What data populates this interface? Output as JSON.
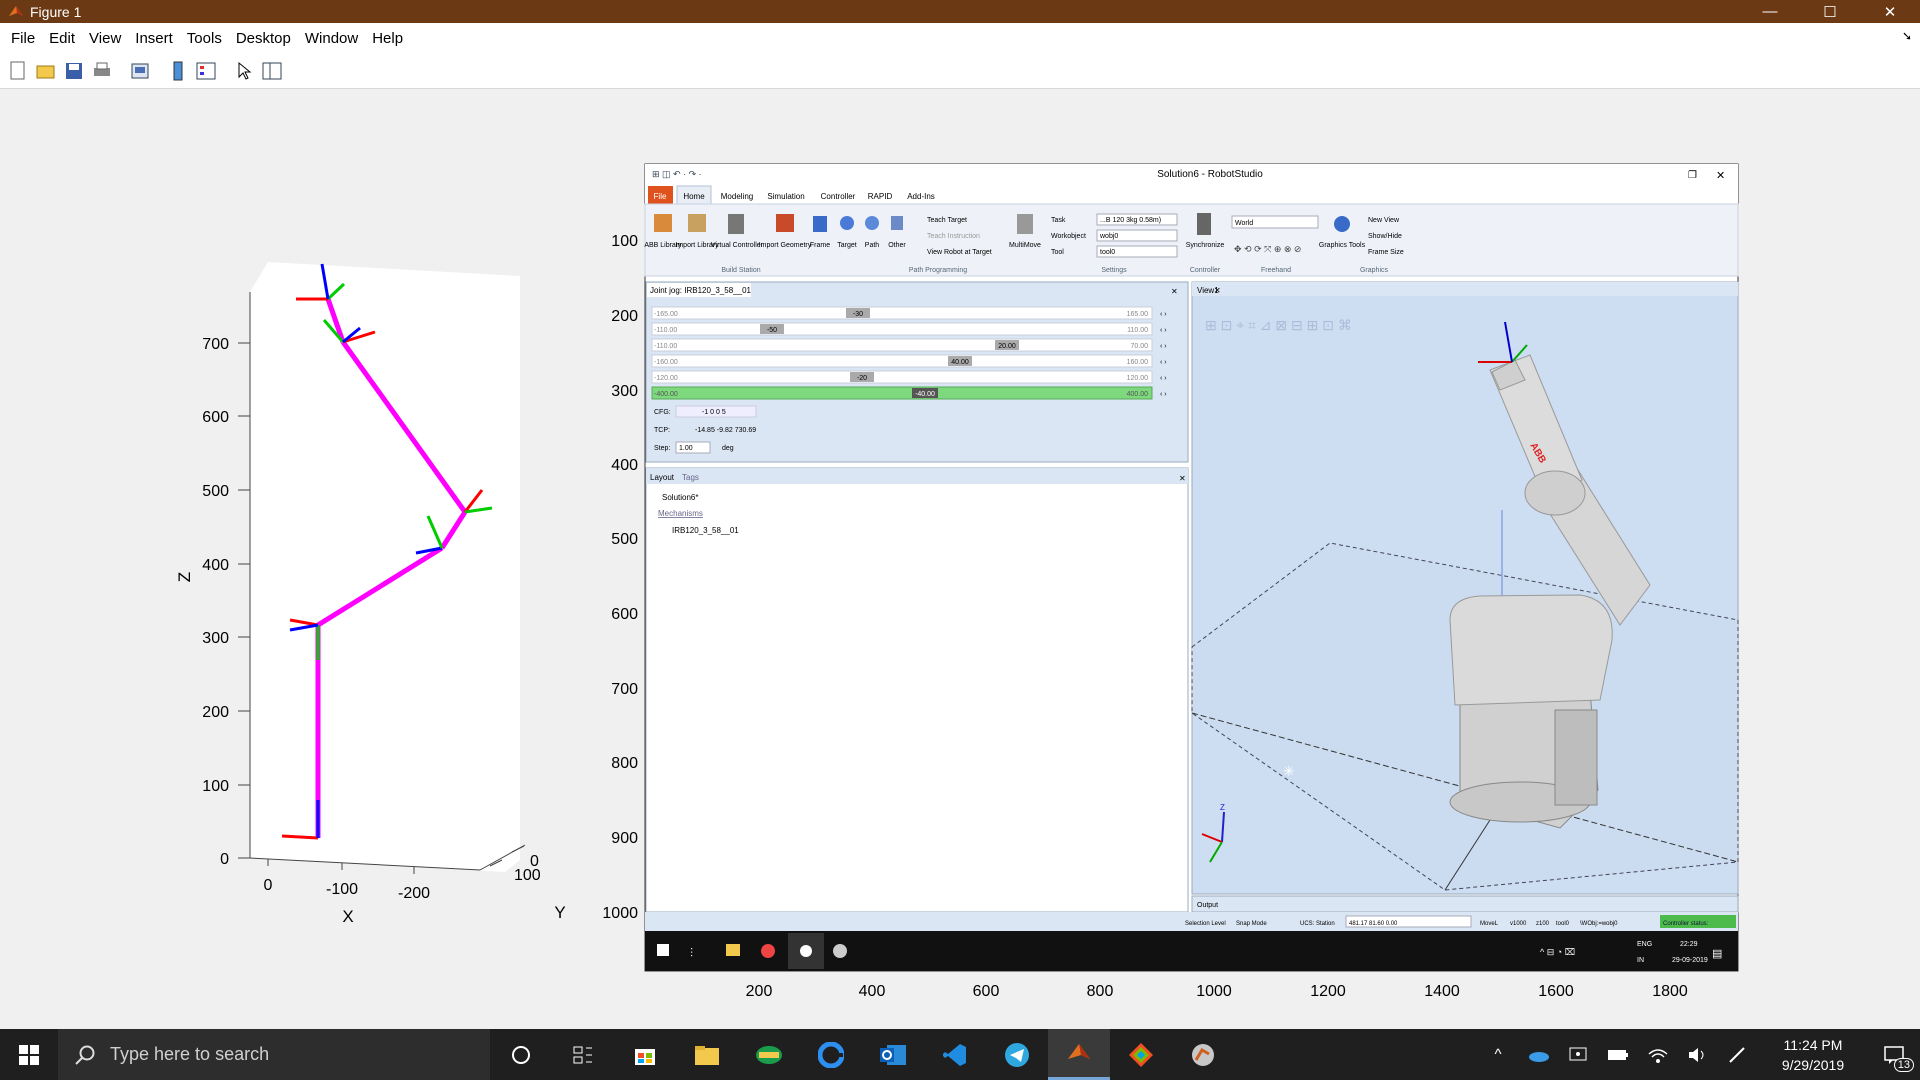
{
  "window": {
    "title": "Figure 1",
    "minimize_glyph": "—",
    "maximize_glyph": "☐",
    "close_glyph": "✕"
  },
  "menu": [
    "File",
    "Edit",
    "View",
    "Insert",
    "Tools",
    "Desktop",
    "Window",
    "Help"
  ],
  "toolbar": {
    "icons": [
      "new-figure-icon",
      "open-icon",
      "save-icon",
      "print-icon",
      "link-plot-icon",
      "insert-colorbar-icon",
      "insert-legend-icon",
      "edit-plot-icon",
      "property-inspector-icon"
    ]
  },
  "plot3d": {
    "z_label": "Z",
    "x_label": "X",
    "y_label": "Y",
    "z_ticks": [
      "0",
      "100",
      "200",
      "300",
      "400",
      "500",
      "600",
      "700"
    ],
    "x_ticks": [
      "0",
      "-100",
      "-200"
    ],
    "y_ticks": [
      "0",
      "100"
    ],
    "link_color": "#ff00ff",
    "frame_colors": {
      "x": "#ff0000",
      "y": "#00cc00",
      "z": "#0000ff"
    }
  },
  "image_axes": {
    "y_ticks": [
      "100",
      "200",
      "300",
      "400",
      "500",
      "600",
      "700",
      "800",
      "900",
      "1000"
    ],
    "x_ticks": [
      "200",
      "400",
      "600",
      "800",
      "1000",
      "1200",
      "1400",
      "1600",
      "1800"
    ]
  },
  "robotstudio": {
    "title": "Solution6 - RobotStudio",
    "tabs": [
      "File",
      "Home",
      "Modeling",
      "Simulation",
      "Controller",
      "RAPID",
      "Add-Ins"
    ],
    "ribbon_buttons": [
      {
        "label": "ABB Library"
      },
      {
        "label": "Import Library"
      },
      {
        "label": "Virtual Controller"
      },
      {
        "label": "Import Geometry"
      },
      {
        "label": "Frame"
      },
      {
        "label": "Target"
      },
      {
        "label": "Path"
      },
      {
        "label": "Other"
      }
    ],
    "ribbon_small": [
      "Teach Target",
      "Teach Instruction",
      "View Robot at Target"
    ],
    "multimove": "MultiMove",
    "settings_labels": [
      "Task",
      "Workobject",
      "Tool"
    ],
    "settings_values": [
      "...B 120 3kg 0.58m)",
      "wobj0",
      "tool0"
    ],
    "synchronize": "Synchronize",
    "world_value": "World",
    "graphics_tools": "Graphics Tools",
    "graphics_small": [
      "New View",
      "Show/Hide",
      "Frame Size"
    ],
    "groups": [
      "Build Station",
      "Path Programming",
      "Settings",
      "Controller",
      "Freehand",
      "Graphics"
    ],
    "jog_tab": "Joint jog: IRB120_3_58__01",
    "jog_rows": [
      {
        "min": "-165.00",
        "max": "165.00",
        "val": "-30"
      },
      {
        "min": "-110.00",
        "max": "110.00",
        "val": "-50"
      },
      {
        "min": "-110.00",
        "max": "70.00",
        "val": "20.00"
      },
      {
        "min": "-160.00",
        "max": "160.00",
        "val": "40.00"
      },
      {
        "min": "-120.00",
        "max": "120.00",
        "val": "-20"
      },
      {
        "min": "-400.00",
        "max": "400.00",
        "val": "-40.00"
      }
    ],
    "cfg_label": "CFG:",
    "cfg_value": "-1 0 0 5",
    "tcp_label": "TCP:",
    "tcp_value": "-14.85 -9.82 730.69",
    "step_label": "Step:",
    "step_value": "1.00",
    "step_unit": "deg",
    "layout_tabs": [
      "Layout",
      "Tags"
    ],
    "tree": [
      "Solution6*",
      "Mechanisms",
      "IRB120_3_58__01"
    ],
    "view_tab": "View1",
    "toolbar_glyphs": "⊞ ⊡ ⌖ ⌗ ⊿ ⊠ ⊟ ⊞ ⊡ ⌘",
    "output_tab": "Output",
    "status_items": [
      "Selection Level",
      "Snap Mode",
      "UCS: Station",
      "481.17 81.60 0.00",
      "MoveL",
      "v1000",
      "z100",
      "tool0",
      "\\WObj:=wobj0"
    ],
    "status_controller": "Controller status:",
    "inner_tray_lang": "ENG",
    "inner_tray_region": "IN",
    "inner_time": "22:29",
    "inner_date": "29-09-2019"
  },
  "taskbar": {
    "search_placeholder": "Type here to search",
    "time": "11:24 PM",
    "date": "9/29/2019",
    "notification_count": "13"
  }
}
